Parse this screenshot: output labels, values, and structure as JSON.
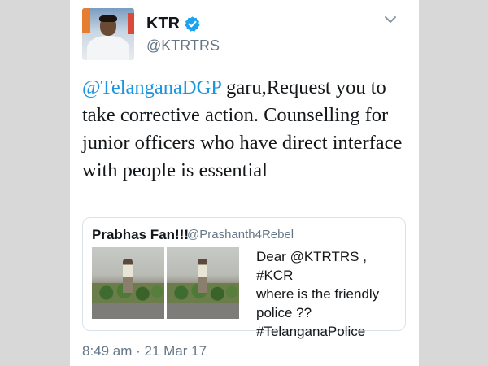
{
  "author": {
    "name": "KTR",
    "handle": "@KTRTRS",
    "verified": true
  },
  "tweet": {
    "mention": "@TelanganaDGP",
    "text": " garu,Request you to take corrective action. Counselling for junior officers who have direct interface with people is essential"
  },
  "quoted_tweet": {
    "name": "Prabhas Fan!!!",
    "handle": "@Prashanth4Rebel",
    "text_lines": [
      "Dear @KTRTRS , #KCR",
      "where is the friendly",
      "police ??",
      "#TelanganaPolice"
    ]
  },
  "timestamp": "8:49 am · 21 Mar 17",
  "colors": {
    "link": "#1b95e0",
    "verified_badge": "#1da1f2",
    "secondary_text": "#657786"
  },
  "icons": [
    "verified-badge-icon",
    "chevron-down-icon"
  ]
}
